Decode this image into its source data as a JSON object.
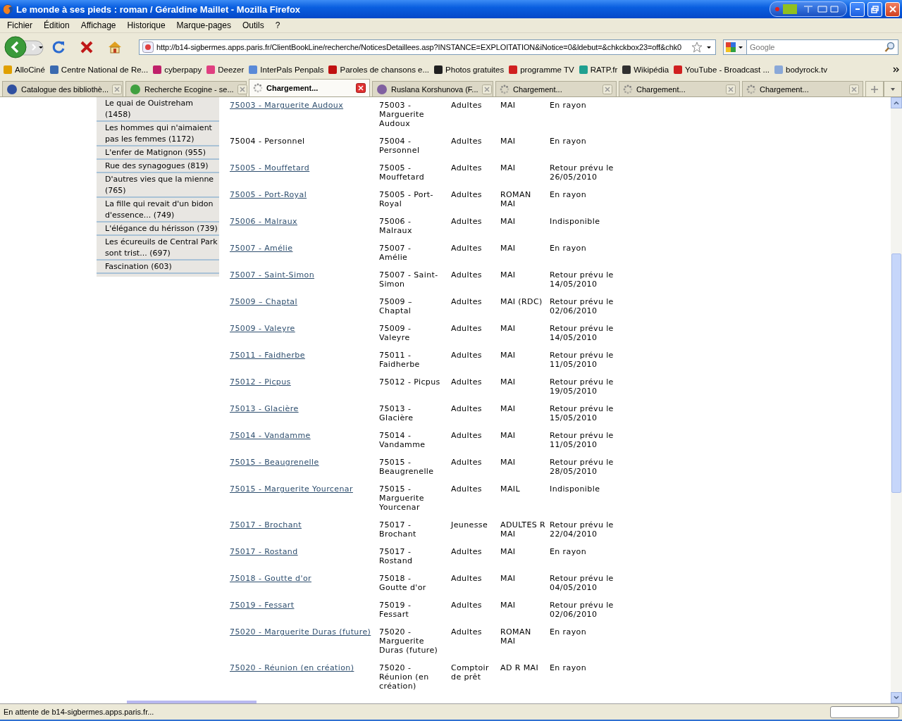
{
  "window": {
    "title": "Le monde à ses pieds : roman / Géraldine Maillet - Mozilla Firefox"
  },
  "menu": [
    "Fichier",
    "Édition",
    "Affichage",
    "Historique",
    "Marque-pages",
    "Outils",
    "?"
  ],
  "address": {
    "value": "http://b14-sigbermes.apps.paris.fr/ClientBookLine/recherche/NoticesDetaillees.asp?INSTANCE=EXPLOITATION&iNotice=0&ldebut=&chkckbox23=off&chk0"
  },
  "search": {
    "placeholder": "Google"
  },
  "bookmarks": [
    {
      "label": "AlloCiné",
      "color": "#e0a000"
    },
    {
      "label": "Centre National de Re...",
      "color": "#3a6ab0"
    },
    {
      "label": "cyberpapy",
      "color": "#c0206a"
    },
    {
      "label": "Deezer",
      "color": "#e04080"
    },
    {
      "label": "InterPals Penpals",
      "color": "#5a8ad8"
    },
    {
      "label": "Paroles de chansons e...",
      "color": "#c01010"
    },
    {
      "label": "Photos gratuites",
      "color": "#202020"
    },
    {
      "label": "programme TV",
      "color": "#d02020"
    },
    {
      "label": "RATP.fr",
      "color": "#20a090"
    },
    {
      "label": "Wikipédia",
      "color": "#303030"
    },
    {
      "label": "YouTube - Broadcast ...",
      "color": "#d02020"
    },
    {
      "label": "bodyrock.tv",
      "color": "#8aa8d8"
    }
  ],
  "tabs": [
    {
      "label": "Catalogue des bibliothè...",
      "selected": false,
      "loading": false
    },
    {
      "label": "Recherche Ecogine - se...",
      "selected": false,
      "loading": false
    },
    {
      "label": "Chargement...",
      "selected": true,
      "loading": true
    },
    {
      "label": "Ruslana Korshunova (F...",
      "selected": false,
      "loading": false
    },
    {
      "label": "Chargement...",
      "selected": false,
      "loading": true
    },
    {
      "label": "Chargement...",
      "selected": false,
      "loading": true
    },
    {
      "label": "Chargement...",
      "selected": false,
      "loading": true
    }
  ],
  "sidebar": {
    "items": [
      "Le quai de Ouistreham (1458)",
      "Les hommes qui n'aimaient pas les femmes (1172)",
      "L'enfer de Matignon (955)",
      "Rue des synagogues (819)",
      "D'autres vies que la mienne (765)",
      "La fille qui revait d'un bidon d'essence... (749)",
      "L'élégance du hérisson (739)",
      "Les écureuils de Central Park sont trist... (697)",
      "Fascination (603)"
    ]
  },
  "table": {
    "rows": [
      {
        "library": "75003 - Marguerite Audoux",
        "link": true,
        "branch": "75003 - Marguerite Audoux",
        "section": "Adultes",
        "location": "MAI",
        "status": "En rayon"
      },
      {
        "library": "75004 - Personnel",
        "link": false,
        "branch": "75004 - Personnel",
        "section": "Adultes",
        "location": "MAI",
        "status": "En rayon"
      },
      {
        "library": "75005 - Mouffetard",
        "link": true,
        "branch": "75005 - Mouffetard",
        "section": "Adultes",
        "location": "MAI",
        "status": "Retour prévu le 26/05/2010"
      },
      {
        "library": "75005 - Port-Royal",
        "link": true,
        "branch": "75005 - Port-Royal",
        "section": "Adultes",
        "location": "ROMAN MAI",
        "status": "En rayon"
      },
      {
        "library": "75006 - Malraux",
        "link": true,
        "branch": "75006 - Malraux",
        "section": "Adultes",
        "location": "MAI",
        "status": "Indisponible"
      },
      {
        "library": "75007 - Amélie",
        "link": true,
        "branch": "75007 - Amélie",
        "section": "Adultes",
        "location": "MAI",
        "status": "En rayon"
      },
      {
        "library": "75007 - Saint-Simon",
        "link": true,
        "branch": "75007 - Saint-Simon",
        "section": "Adultes",
        "location": "MAI",
        "status": "Retour prévu le 14/05/2010"
      },
      {
        "library": "75009 – Chaptal",
        "link": true,
        "branch": "75009 – Chaptal",
        "section": "Adultes",
        "location": "MAI (RDC)",
        "status": "Retour prévu le 02/06/2010"
      },
      {
        "library": "75009 - Valeyre",
        "link": true,
        "branch": "75009 - Valeyre",
        "section": "Adultes",
        "location": "MAI",
        "status": "Retour prévu le 14/05/2010"
      },
      {
        "library": "75011 - Faidherbe",
        "link": true,
        "branch": "75011 - Faidherbe",
        "section": "Adultes",
        "location": "MAI",
        "status": "Retour prévu le 11/05/2010"
      },
      {
        "library": "75012 - Picpus",
        "link": true,
        "branch": "75012 - Picpus",
        "section": "Adultes",
        "location": "MAI",
        "status": "Retour prévu le 19/05/2010"
      },
      {
        "library": "75013 - Glacière",
        "link": true,
        "branch": "75013 - Glacière",
        "section": "Adultes",
        "location": "MAI",
        "status": "Retour prévu le 15/05/2010"
      },
      {
        "library": "75014 - Vandamme",
        "link": true,
        "branch": "75014 - Vandamme",
        "section": "Adultes",
        "location": "MAI",
        "status": "Retour prévu le 11/05/2010"
      },
      {
        "library": "75015 - Beaugrenelle",
        "link": true,
        "branch": "75015 - Beaugrenelle",
        "section": "Adultes",
        "location": "MAI",
        "status": "Retour prévu le 28/05/2010"
      },
      {
        "library": "75015 - Marguerite Yourcenar",
        "link": true,
        "branch": "75015 - Marguerite Yourcenar",
        "section": "Adultes",
        "location": "MAIL",
        "status": "Indisponible"
      },
      {
        "library": "75017 - Brochant",
        "link": true,
        "branch": "75017 - Brochant",
        "section": "Jeunesse",
        "location": "ADULTES R MAI",
        "status": "Retour prévu le 22/04/2010"
      },
      {
        "library": "75017 - Rostand",
        "link": true,
        "branch": "75017 - Rostand",
        "section": "Adultes",
        "location": "MAI",
        "status": "En rayon"
      },
      {
        "library": "75018 - Goutte d'or",
        "link": true,
        "branch": "75018 - Goutte d'or",
        "section": "Adultes",
        "location": "MAI",
        "status": "Retour prévu le 04/05/2010"
      },
      {
        "library": "75019 - Fessart",
        "link": true,
        "branch": "75019 - Fessart",
        "section": "Adultes",
        "location": "MAI",
        "status": "Retour prévu le 02/06/2010"
      },
      {
        "library": "75020 - Marguerite Duras (future)",
        "link": true,
        "branch": "75020 - Marguerite Duras (future)",
        "section": "Adultes",
        "location": "ROMAN MAI",
        "status": "En rayon"
      },
      {
        "library": "75020 - Réunion (en création)",
        "link": true,
        "branch": "75020 - Réunion (en création)",
        "section": "Comptoir de prêt",
        "location": "AD R MAI",
        "status": "En rayon"
      }
    ]
  },
  "status_bar": {
    "text": "En attente de b14-sigbermes.apps.paris.fr..."
  }
}
